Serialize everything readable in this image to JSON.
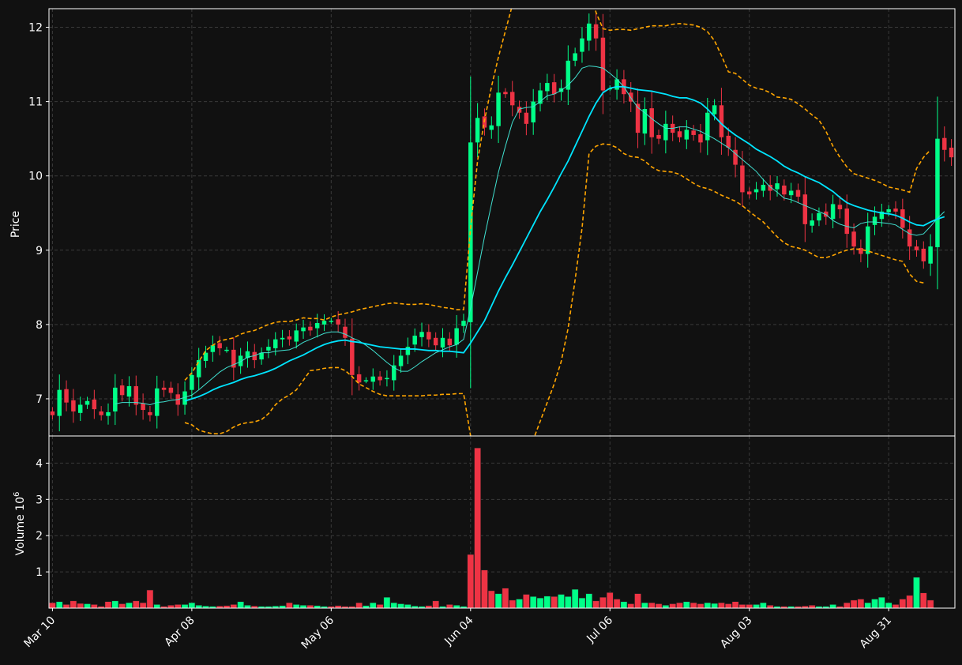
{
  "colors": {
    "background": "#111111",
    "up": "#00ff88",
    "down": "#ee3344",
    "grid": "#3a3a3a",
    "axes": "#ffffff",
    "ma_slow": "#00e5ff",
    "ma_fast": "#40e0d0",
    "bands": "#ffa500"
  },
  "chart_data": [
    {
      "type": "candlestick",
      "panel": "price",
      "ylabel": "Price",
      "ylim": [
        6.5,
        12.25
      ],
      "yticks": [
        7,
        8,
        9,
        10,
        11,
        12
      ],
      "grid": true,
      "x_tick_labels": [
        "Mar 10",
        "Apr 08",
        "May 06",
        "Jun 04",
        "Jul 06",
        "Aug 03",
        "Aug 31"
      ],
      "x_tick_positions": [
        0,
        20,
        40,
        60,
        80,
        100,
        120
      ],
      "bars": 127,
      "series": [
        {
          "role": "candles"
        },
        {
          "role": "moving-average-fast",
          "color": "#40e0d0"
        },
        {
          "role": "moving-average-slow",
          "color": "#00e5ff"
        },
        {
          "role": "upper-band",
          "color": "#ffa500",
          "style": "dashed"
        },
        {
          "role": "lower-band",
          "color": "#ffa500",
          "style": "dashed"
        }
      ],
      "close": [
        6.78,
        7.12,
        6.95,
        6.83,
        6.92,
        6.97,
        6.86,
        6.78,
        6.82,
        7.15,
        7.05,
        7.17,
        6.92,
        6.85,
        6.78,
        7.14,
        7.12,
        7.08,
        6.92,
        7.1,
        7.32,
        7.52,
        7.62,
        7.72,
        7.68,
        7.66,
        7.42,
        7.58,
        7.64,
        7.52,
        7.62,
        7.7,
        7.8,
        7.82,
        7.8,
        7.92,
        7.96,
        7.92,
        8.02,
        8.05,
        8.05,
        8,
        7.82,
        7.32,
        7.22,
        7.25,
        7.3,
        7.25,
        7.28,
        7.45,
        7.58,
        7.7,
        7.85,
        7.9,
        7.8,
        7.72,
        7.82,
        7.72,
        7.95,
        8.05,
        10.45,
        10.78,
        10.65,
        10.68,
        11.12,
        11.1,
        10.95,
        10.85,
        10.7,
        11,
        11.15,
        11.25,
        11.1,
        11.18,
        11.55,
        11.65,
        11.85,
        12.05,
        11.85,
        11.15,
        11.18,
        11.3,
        11.1,
        11,
        10.58,
        10.9,
        10.52,
        10.5,
        10.7,
        10.58,
        10.52,
        10.62,
        10.55,
        10.45,
        10.85,
        10.95,
        10.52,
        10.38,
        10.15,
        9.78,
        9.75,
        9.82,
        9.88,
        9.8,
        9.9,
        9.75,
        9.8,
        9.72,
        9.35,
        9.4,
        9.5,
        9.45,
        9.62,
        9.55,
        9.22,
        9.05,
        8.95,
        9.32,
        9.45,
        9.52,
        9.55,
        9.52,
        9.3,
        9.05,
        9,
        8.85,
        9.05,
        10.5,
        10.35,
        10.25
      ],
      "ma_fast": [
        null,
        null,
        null,
        null,
        null,
        null,
        null,
        null,
        null,
        6.93,
        6.95,
        6.95,
        6.95,
        6.94,
        6.92,
        6.95,
        6.96,
        6.98,
        6.99,
        7.02,
        7.05,
        7.12,
        7.2,
        7.28,
        7.36,
        7.42,
        7.46,
        7.5,
        7.56,
        7.58,
        7.62,
        7.62,
        7.64,
        7.65,
        7.66,
        7.7,
        7.76,
        7.8,
        7.84,
        7.88,
        7.9,
        7.9,
        7.87,
        7.82,
        7.78,
        7.72,
        7.65,
        7.57,
        7.49,
        7.42,
        7.37,
        7.37,
        7.43,
        7.5,
        7.56,
        7.62,
        7.66,
        7.7,
        7.73,
        7.8,
        8.22,
        8.7,
        9.18,
        9.62,
        10.05,
        10.4,
        10.72,
        10.9,
        10.92,
        10.93,
        11,
        11.08,
        11.1,
        11.15,
        11.22,
        11.32,
        11.45,
        11.48,
        11.47,
        11.45,
        11.38,
        11.3,
        11.2,
        11.05,
        10.92,
        10.85,
        10.77,
        10.7,
        10.64,
        10.64,
        10.66,
        10.66,
        10.63,
        10.6,
        10.55,
        10.5,
        10.44,
        10.38,
        10.3,
        10.22,
        10.14,
        10.06,
        9.95,
        9.85,
        9.78,
        9.7,
        9.68,
        9.64,
        9.6,
        9.56,
        9.52,
        9.48,
        9.4,
        9.35,
        9.32,
        9.3,
        9.36,
        9.38,
        9.38,
        9.37,
        9.36,
        9.34,
        9.28,
        9.22,
        9.2,
        9.22,
        9.32,
        9.43,
        9.52
      ],
      "ma_slow": [
        null,
        null,
        null,
        null,
        null,
        null,
        null,
        null,
        null,
        null,
        null,
        null,
        null,
        null,
        null,
        null,
        null,
        null,
        null,
        6.97,
        7.0,
        7.03,
        7.07,
        7.12,
        7.16,
        7.19,
        7.22,
        7.26,
        7.29,
        7.31,
        7.34,
        7.37,
        7.41,
        7.46,
        7.51,
        7.55,
        7.59,
        7.64,
        7.69,
        7.73,
        7.76,
        7.78,
        7.79,
        7.77,
        7.76,
        7.74,
        7.72,
        7.7,
        7.69,
        7.68,
        7.67,
        7.67,
        7.67,
        7.66,
        7.65,
        7.65,
        7.64,
        7.64,
        7.63,
        7.62,
        7.75,
        7.9,
        8.05,
        8.25,
        8.45,
        8.63,
        8.8,
        8.98,
        9.16,
        9.34,
        9.52,
        9.68,
        9.85,
        10.03,
        10.2,
        10.4,
        10.6,
        10.8,
        10.98,
        11.12,
        11.18,
        11.2,
        11.2,
        11.18,
        11.16,
        11.15,
        11.14,
        11.12,
        11.1,
        11.07,
        11.05,
        11.05,
        11.02,
        10.98,
        10.9,
        10.8,
        10.7,
        10.62,
        10.55,
        10.49,
        10.43,
        10.36,
        10.31,
        10.26,
        10.2,
        10.13,
        10.08,
        10.04,
        9.99,
        9.95,
        9.91,
        9.85,
        9.79,
        9.71,
        9.64,
        9.6,
        9.57,
        9.54,
        9.52,
        9.5,
        9.49,
        9.47,
        9.43,
        9.38,
        9.34,
        9.33,
        9.38,
        9.42,
        9.45
      ],
      "upper_band": [
        null,
        null,
        null,
        null,
        null,
        null,
        null,
        null,
        null,
        null,
        null,
        null,
        null,
        null,
        null,
        null,
        null,
        null,
        null,
        7.25,
        7.35,
        7.5,
        7.65,
        7.72,
        7.78,
        7.8,
        7.82,
        7.87,
        7.9,
        7.92,
        7.96,
        8.0,
        8.03,
        8.04,
        8.04,
        8.06,
        8.09,
        8.08,
        8.08,
        8.06,
        8.1,
        8.13,
        8.15,
        8.17,
        8.2,
        8.22,
        8.24,
        8.26,
        8.28,
        8.29,
        8.28,
        8.27,
        8.27,
        8.28,
        8.27,
        8.25,
        8.23,
        8.22,
        8.2,
        8.2,
        9.3,
        10.2,
        10.75,
        11.2,
        11.6,
        11.95,
        12.3,
        12.6,
        12.85,
        13.05,
        13.2,
        13.3,
        13.35,
        13.3,
        13.2,
        13.05,
        12.85,
        12.6,
        12.2,
        11.98,
        11.96,
        11.97,
        11.97,
        11.96,
        11.98,
        12.0,
        12.02,
        12.02,
        12.02,
        12.04,
        12.05,
        12.04,
        12.03,
        12.0,
        11.94,
        11.82,
        11.62,
        11.4,
        11.38,
        11.3,
        11.22,
        11.18,
        11.16,
        11.12,
        11.06,
        11.05,
        11.03,
        10.97,
        10.9,
        10.82,
        10.75,
        10.6,
        10.4,
        10.25,
        10.12,
        10.03,
        10.0,
        9.97,
        9.94,
        9.9,
        9.85,
        9.83,
        9.81,
        9.78,
        10.1,
        10.25,
        10.35
      ],
      "lower_band": [
        null,
        null,
        null,
        null,
        null,
        null,
        null,
        null,
        null,
        null,
        null,
        null,
        null,
        null,
        null,
        null,
        null,
        null,
        null,
        6.68,
        6.65,
        6.58,
        6.55,
        6.53,
        6.53,
        6.56,
        6.62,
        6.66,
        6.68,
        6.69,
        6.72,
        6.8,
        6.92,
        7.0,
        7.05,
        7.12,
        7.25,
        7.38,
        7.39,
        7.41,
        7.42,
        7.42,
        7.38,
        7.3,
        7.2,
        7.15,
        7.1,
        7.06,
        7.04,
        7.04,
        7.04,
        7.04,
        7.04,
        7.04,
        7.05,
        7.05,
        7.06,
        7.06,
        7.07,
        7.07,
        6.5,
        5.6,
        5.35,
        5.3,
        5.3,
        5.4,
        5.6,
        5.9,
        6.2,
        6.45,
        6.7,
        6.95,
        7.2,
        7.5,
        7.95,
        8.6,
        9.3,
        10.3,
        10.4,
        10.43,
        10.42,
        10.38,
        10.3,
        10.26,
        10.25,
        10.2,
        10.12,
        10.07,
        10.06,
        10.05,
        10.02,
        9.96,
        9.9,
        9.85,
        9.83,
        9.79,
        9.74,
        9.7,
        9.66,
        9.6,
        9.52,
        9.45,
        9.38,
        9.28,
        9.18,
        9.1,
        9.05,
        9.03,
        9.0,
        8.95,
        8.9,
        8.9,
        8.93,
        8.97,
        9.0,
        9.02,
        9.01,
        8.99,
        8.96,
        8.93,
        8.9,
        8.87,
        8.85,
        8.68,
        8.58,
        8.56
      ]
    },
    {
      "type": "bar",
      "panel": "volume",
      "ylabel": "Volume  10^6",
      "ylim": [
        0,
        4.75
      ],
      "yticks": [
        1,
        2,
        3,
        4
      ],
      "grid": true,
      "values_millions": [
        0.15,
        0.18,
        0.1,
        0.2,
        0.13,
        0.12,
        0.1,
        0.05,
        0.18,
        0.2,
        0.12,
        0.15,
        0.2,
        0.15,
        0.5,
        0.1,
        0.05,
        0.08,
        0.1,
        0.1,
        0.15,
        0.08,
        0.06,
        0.05,
        0.06,
        0.07,
        0.1,
        0.18,
        0.08,
        0.06,
        0.05,
        0.05,
        0.06,
        0.07,
        0.15,
        0.1,
        0.08,
        0.08,
        0.07,
        0.05,
        0.05,
        0.07,
        0.05,
        0.05,
        0.15,
        0.07,
        0.15,
        0.1,
        0.3,
        0.15,
        0.12,
        0.1,
        0.06,
        0.05,
        0.07,
        0.2,
        0.05,
        0.1,
        0.08,
        0.05,
        1.48,
        4.42,
        1.05,
        0.48,
        0.4,
        0.55,
        0.22,
        0.25,
        0.38,
        0.32,
        0.28,
        0.33,
        0.32,
        0.38,
        0.32,
        0.52,
        0.28,
        0.4,
        0.2,
        0.3,
        0.43,
        0.25,
        0.18,
        0.12,
        0.4,
        0.15,
        0.15,
        0.12,
        0.08,
        0.12,
        0.15,
        0.18,
        0.15,
        0.12,
        0.15,
        0.13,
        0.15,
        0.12,
        0.18,
        0.1,
        0.1,
        0.1,
        0.15,
        0.08,
        0.05,
        0.05,
        0.05,
        0.05,
        0.06,
        0.08,
        0.05,
        0.05,
        0.1,
        0.05,
        0.15,
        0.22,
        0.25,
        0.15,
        0.25,
        0.3,
        0.15,
        0.1,
        0.25,
        0.35,
        0.85,
        0.42,
        0.22
      ],
      "direction": [
        "down",
        "up",
        "down",
        "down",
        "down",
        "up",
        "down",
        "down",
        "down",
        "up",
        "down",
        "up",
        "down",
        "down",
        "down",
        "up",
        "down",
        "down",
        "down",
        "up",
        "up",
        "up",
        "up",
        "up",
        "down",
        "down",
        "down",
        "up",
        "up",
        "down",
        "up",
        "up",
        "up",
        "up",
        "down",
        "up",
        "up",
        "down",
        "up",
        "up",
        "down",
        "down",
        "down",
        "down",
        "down",
        "up",
        "up",
        "down",
        "up",
        "up",
        "up",
        "up",
        "up",
        "up",
        "down",
        "down",
        "up",
        "down",
        "up",
        "up",
        "down",
        "down",
        "down",
        "down",
        "up",
        "down",
        "down",
        "up",
        "down",
        "up",
        "up",
        "up",
        "down",
        "up",
        "up",
        "up",
        "up",
        "up",
        "down",
        "down",
        "down",
        "down",
        "up",
        "down",
        "down",
        "up",
        "down",
        "down",
        "up",
        "down",
        "down",
        "up",
        "down",
        "down",
        "up",
        "up",
        "down",
        "down",
        "down",
        "down",
        "down",
        "up",
        "up",
        "down",
        "up",
        "down",
        "up",
        "down",
        "down",
        "down",
        "up",
        "up",
        "up",
        "down",
        "down",
        "down",
        "down",
        "up",
        "up",
        "up",
        "up",
        "down",
        "down",
        "down",
        "up",
        "down",
        "down"
      ]
    }
  ]
}
